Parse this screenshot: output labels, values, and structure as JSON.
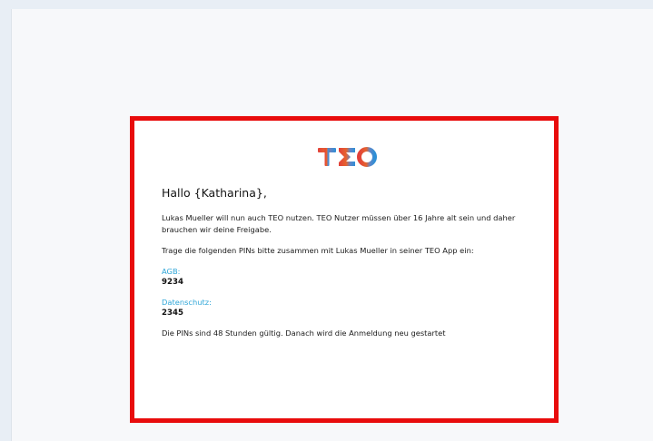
{
  "email": {
    "logo_text": "TEO",
    "greeting": "Hallo {Katharina},",
    "paragraph_1": "Lukas Mueller will nun auch TEO nutzen. TEO Nutzer müssen über 16 Jahre alt sein und daher brauchen wir deine Freigabe.",
    "paragraph_2": "Trage die folgenden PINs bitte zusammen mit Lukas Mueller in seiner TEO App ein:",
    "pins": [
      {
        "label": "AGB:",
        "value": "9234"
      },
      {
        "label": "Datenschutz:",
        "value": "2345"
      }
    ],
    "footer": "Die PINs sind 48 Stunden gültig. Danach wird die Anmeldung neu gestartet"
  },
  "colors": {
    "highlight_border": "#e80c0c",
    "pin_label": "#2fa6d8",
    "logo_gradient": [
      "#e2403a",
      "#e6632d",
      "#5f86c9",
      "#2d8fd6"
    ]
  }
}
